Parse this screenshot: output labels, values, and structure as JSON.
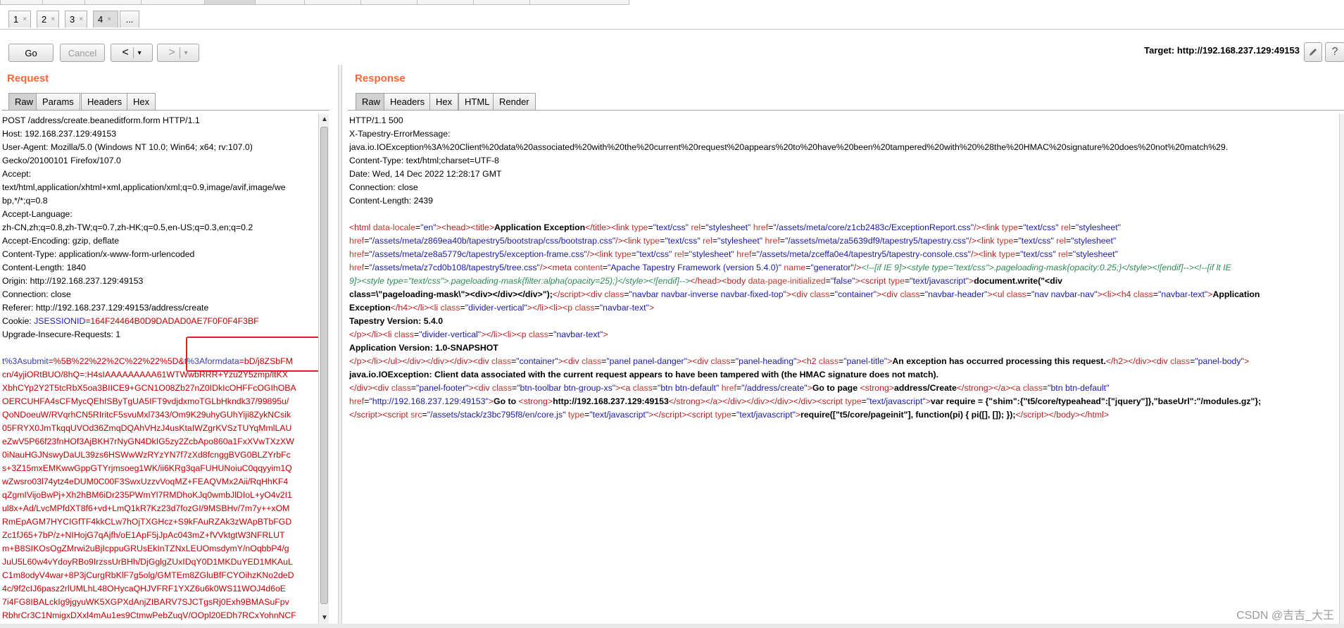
{
  "tabs": [
    {
      "label": "1",
      "close": "×"
    },
    {
      "label": "2",
      "close": "×"
    },
    {
      "label": "3",
      "close": "×"
    },
    {
      "label": "4",
      "close": "×"
    },
    {
      "label": "..."
    }
  ],
  "toolbar": {
    "go": "Go",
    "cancel": "Cancel",
    "back": "<",
    "back_drop": "▾",
    "forward": ">",
    "forward_drop": "▾",
    "target": "Target: http://192.168.237.129:49153",
    "edit_icon": "pencil-icon",
    "help": "?"
  },
  "request": {
    "title": "Request",
    "tabs": [
      "Raw",
      "Params",
      "Headers",
      "Hex"
    ],
    "lines": [
      "POST /address/create.beaneditform.form HTTP/1.1",
      "Host: 192.168.237.129:49153",
      "User-Agent: Mozilla/5.0 (Windows NT 10.0; Win64; x64; rv:107.0)",
      "Gecko/20100101 Firefox/107.0",
      "Accept:",
      "text/html,application/xhtml+xml,application/xml;q=0.9,image/avif,image/we",
      "bp,*/*;q=0.8",
      "Accept-Language:",
      "zh-CN,zh;q=0.8,zh-TW;q=0.7,zh-HK;q=0.5,en-US;q=0.3,en;q=0.2",
      "Accept-Encoding: gzip, deflate",
      "Content-Type: application/x-www-form-urlencoded",
      "Content-Length: 1840",
      "Origin: http://192.168.237.129:49153",
      "Connection: close",
      "Referer: http://192.168.237.129:49153/address/create"
    ],
    "cookie_prefix": "Cookie: ",
    "cookie_name": "JSESSIONID",
    "cookie_value": "=164F24464B0D9DADAD0AE7F0F0F4F3BF",
    "upgrade": "Upgrade-Insecure-Requests: 1",
    "body_p1_name": "t%3Asubmit",
    "body_p1_val": "=%5B%22%22%2C%22%22%5D&",
    "body_p2_name": "t%3Aformdata",
    "body_p2_val": "=bD/j8ZSbFM",
    "body_lines": [
      "cn/4yjiORtBUO/8hQ=:H4sIAAAAAAAAA61WTWwbRRR+Yzu2Y5zmp/ltKX",
      "XbhCYp2Y2T5tcRbX5oa3BIICE9+GCN1O08Zb27nZ0IDkIcOHFFcOGIhOBA",
      "OERCUHFA4sCFMycQEhISByTgUA5IFT9vdjdxmoTGLbHkndk37/99895u/",
      "QoNDoeuW/RVqrhCN5RIritcF5svuMxl7343/Om9K29uhyGUhYiji8ZykNCsik",
      "05FRYX0JmTkqqUVOd36ZmqDQAhVHzJ4usKtaIWZgrKVSzTUYqMmlLAU",
      "eZwV5P66f23fnHOf3AjBKH7rNyGN4DkIG5zy2ZcbApo860a1FxXVwTXzXW",
      "0iNauHGJNswyDaUL39zs6HSWwWzRYzYN7f7zXd8fcnggBVG0BLZYrbFc",
      "s+3Z15mxEMKwwGppGTYrjmsoeg1WK/ii6KRg3qaFUHUNoiuC0qqyyim1Q",
      "wZwsro03l74ytz4eDUM0C00F3SwxUzzvVoqMZ+FEAQVMx2Aii/RqHhKF4",
      "qZgmIVijoBwPj+Xh2hBM6iDr235PWmYl7RMDhoKJq0wmbJlDIoL+yO4v2I1",
      "ul8x+Ad/LvcMPfdXT8f6+vd+LmQ1kR7Kz23d7fozGI/9MSBHv/7m7y++xOM",
      "RmEpAGM7HYCIGfTF4kkCLw7hOjTXGHcz+S9kFAuRZAk3zWApBTbFGD",
      "Zc1fJ65+7bP/z+NIHojG7qAjfh/oE1ApF5jJpAc043mZ+fVVktgtW3NFRLUT",
      "m+B8SIKOsOgZMrwi2uBjIcppuGRUsEkInTZNxLEUOmsdymY/nOqbbP4/g",
      "JuU5L60w4vYdoyRBo9IrzssUrBHh/DjGglgZUxIDqY0D1MKDuYED1MKAuL",
      "C1m8odyV4war+8P3jCurgRbKlF7g5olg/GMTEm8ZGluBfFCYOihzKNo2deD",
      "4c/9f2cIJ6pasz2rlUMLhL48OHycaQHJVFRF1YXZ6u6k0WS11WOJ4d6oE",
      "7i4FG8IBALckIg9jgyuWK5XGPXdAnjZIBARV7SJCTgsRj0Exh9BMASuFpv",
      "RbhrCr3C1NmigxDXxl4mAu1es9CtmwPebZuqV/OOpl20EDh7RCxYohnNCF"
    ]
  },
  "response": {
    "title": "Response",
    "tabs": [
      "Raw",
      "Headers",
      "Hex",
      "HTML",
      "Render"
    ],
    "headers": [
      "HTTP/1.1 500",
      "X-Tapestry-ErrorMessage:",
      "java.io.IOException%3A%20Client%20data%20associated%20with%20the%20current%20request%20appears%20to%20have%20been%20tampered%20with%20%28the%20HMAC%20signature%20does%20not%20match%29.",
      "Content-Type: text/html;charset=UTF-8",
      "Date: Wed, 14 Dec 2022 12:28:17 GMT",
      "Connection: close",
      "Content-Length: 2439"
    ],
    "strings": {
      "app_exception": "Application Exception",
      "css_exception": "\"/assets/meta/core/z1cb2483c/ExceptionReport.css\"",
      "css_bootstrap": "\"/assets/meta/z869ea40b/tapestry5/bootstrap/css/bootstrap.css\"",
      "css_tapestry": "\"/assets/meta/za5639df9/tapestry5/tapestry.css\"",
      "css_frame": "\"/assets/meta/ze8a5779c/tapestry5/exception-frame.css\"",
      "css_console": "\"/assets/meta/zceffa0e4/tapestry5/tapestry-console.css\"",
      "css_tree": "\"/assets/meta/z7cd0b108/tapestry5/tree.css\"",
      "generator": "\"Apache Tapestry Framework (version 5.4.0)\"",
      "docwrite": "document.write(\"<div",
      "docwrite2": "class=\\\"pageloading-mask\\\"><div></div></div>\");",
      "tapestry_version": "Tapestry Version: 5.4.0",
      "app_version": "Application Version: 1.0-SNAPSHOT",
      "exception_heading": "An exception has occurred processing this request.",
      "exception_msg": "java.io.IOException: Client data associated with the current request appears to have been tampered with (the HMAC signature does not match).",
      "go_to_page": "Go to page ",
      "address_create": "address/Create",
      "go_to": "Go to ",
      "host_url": "http://192.168.237.129:49153",
      "require_cfg": "var require = {\"shim\":{\"t5/core/typeahead\":[\"jquery\"]},\"baseUrl\":\"/modules.gz\"};",
      "pageinit": "require([\"t5/core/pageinit\"], function(pi) { pi([], []); });"
    }
  },
  "watermark": "CSDN @吉吉_大王"
}
